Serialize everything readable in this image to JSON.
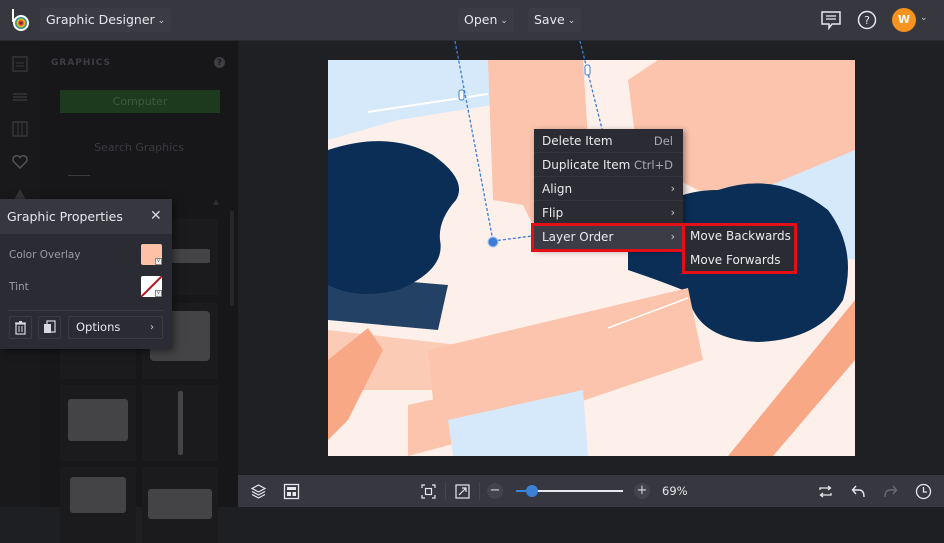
{
  "topbar": {
    "app_name": "Graphic Designer",
    "open_label": "Open",
    "save_label": "Save",
    "avatar_initial": "W",
    "icons": [
      "logo-icon",
      "chat-icon",
      "help-icon",
      "chevron-down-icon"
    ],
    "accent": "#f6921e"
  },
  "leftrail": {
    "icons": [
      "image-icon",
      "text-icon",
      "layout-icon",
      "heart-icon",
      "shape-icon"
    ]
  },
  "leftpanel": {
    "title": "GRAPHICS",
    "help": "?",
    "computer_button": "Computer",
    "search_label": "Search Graphics"
  },
  "graphic_properties": {
    "title": "Graphic Properties",
    "color_overlay_label": "Color Overlay",
    "color_overlay_value": "#fdc1a8",
    "tint_label": "Tint",
    "tint_value": "none",
    "options_label": "Options"
  },
  "context_menu": {
    "items": [
      {
        "label": "Delete Item",
        "shortcut": "Del"
      },
      {
        "label": "Duplicate Item",
        "shortcut": "Ctrl+D"
      },
      {
        "label": "Align",
        "submenu": true
      },
      {
        "label": "Flip",
        "submenu": true
      },
      {
        "label": "Layer Order",
        "submenu": true,
        "active": true
      }
    ],
    "submenu": [
      {
        "label": "Move Backwards"
      },
      {
        "label": "Move Forwards"
      }
    ],
    "highlight_color": "#e40f16"
  },
  "canvas": {
    "colors": {
      "background": "#fdf0ea",
      "navy": "#0b2e57",
      "peach": "#fcc4ac",
      "salmon": "#f9a886",
      "light_blue": "#d6e9fb"
    }
  },
  "bottombar": {
    "zoom_value": "69%",
    "zoom_percent": 69,
    "slider_fraction": 0.15,
    "icons": [
      "layers-icon",
      "layout-grid-icon",
      "fit-screen-icon",
      "expand-icon",
      "zoom-out-icon",
      "zoom-in-icon",
      "swap-icon",
      "undo-icon",
      "redo-icon",
      "history-icon"
    ]
  }
}
